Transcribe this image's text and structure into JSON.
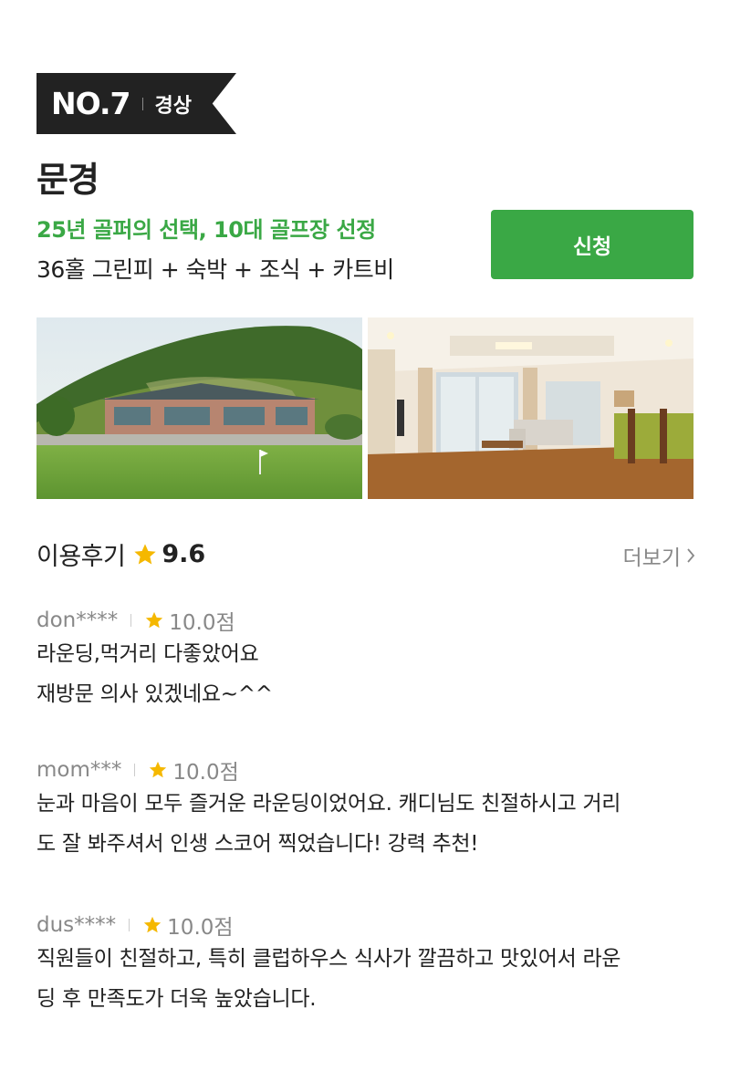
{
  "badge": {
    "rank": "NO.7",
    "region": "경상"
  },
  "course": {
    "name": "문경",
    "highlight": "25년 골퍼의 선택, 10대 골프장 선정",
    "package": "36홀 그린피 + 숙박 + 조식 + 카트비",
    "apply_label": "신청"
  },
  "photos": [
    {
      "icon": "golf-clubhouse-photo"
    },
    {
      "icon": "hotel-room-photo"
    }
  ],
  "reviews_section": {
    "title": "이용후기",
    "score": "9.6",
    "more_label": "더보기",
    "star_color": "#f5b800"
  },
  "reviews": [
    {
      "user": "don****",
      "score": "10.0점",
      "text_lines": [
        "라운딩,먹거리 다좋았어요",
        "재방문 의사 있겠네요~^^"
      ]
    },
    {
      "user": "mom***",
      "score": "10.0점",
      "text_lines": [
        "눈과 마음이 모두 즐거운 라운딩이었어요. 캐디님도 친절하시고 거리",
        "도 잘 봐주셔서 인생 스코어 찍었습니다! 강력 추천!"
      ]
    },
    {
      "user": "dus****",
      "score": "10.0점",
      "text_lines": [
        "직원들이 친절하고, 특히 클럽하우스 식사가 깔끔하고 맛있어서 라운",
        "딩 후 만족도가 더욱 높았습니다."
      ]
    }
  ],
  "colors": {
    "accent": "#3aa845",
    "badge_bg": "#222222"
  }
}
